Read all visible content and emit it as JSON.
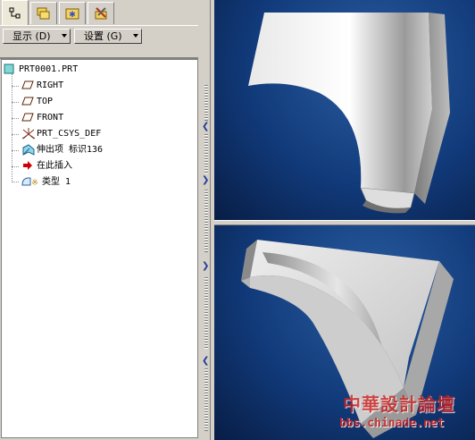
{
  "toolbar": {
    "display_label": "显示 (D)",
    "settings_label": "设置 (G)"
  },
  "tree": {
    "root": "PRT0001.PRT",
    "items": [
      {
        "label": "RIGHT",
        "icon": "datum-plane-icon"
      },
      {
        "label": "TOP",
        "icon": "datum-plane-icon"
      },
      {
        "label": "FRONT",
        "icon": "datum-plane-icon"
      },
      {
        "label": "PRT_CSYS_DEF",
        "icon": "csys-icon"
      },
      {
        "label": "伸出项  标识136",
        "icon": "protrusion-icon"
      },
      {
        "label": "在此插入",
        "icon": "insert-here-arrow-icon"
      },
      {
        "label": "类型  1",
        "icon": "feature-type-icon"
      }
    ]
  },
  "watermark": {
    "title": "中華設計論壇",
    "url": "bbs.chinade.net"
  },
  "colors": {
    "viewport_bg": "#113a7a",
    "part_shade": "#b8b8b8",
    "insert_arrow": "#cc0000",
    "watermark_red": "#cc2222"
  }
}
